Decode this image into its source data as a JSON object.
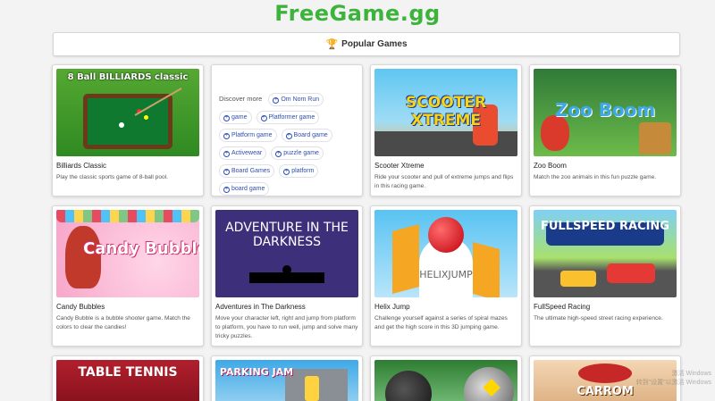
{
  "site": {
    "logo": "FreeGame.gg"
  },
  "section": {
    "title": "Popular Games"
  },
  "discover": {
    "label": "Discover more",
    "tags": [
      "Om Nom Run",
      "game",
      "Platformer game",
      "Platform game",
      "Board game",
      "Activewear",
      "puzzle game",
      "Board Games",
      "platform",
      "board game"
    ]
  },
  "games": [
    {
      "title": "Billiards Classic",
      "desc": "Play the classic sports game of 8-ball pool.",
      "thumb_text": "8 Ball BILLIARDS classic"
    },
    {
      "title": "Scooter Xtreme",
      "desc": "Ride your scooter and pull of extreme jumps and flips in this racing game.",
      "thumb_text": "SCOOTER XTREME"
    },
    {
      "title": "Zoo Boom",
      "desc": "Match the zoo animals in this fun puzzle game.",
      "thumb_text": "Zoo Boom"
    },
    {
      "title": "Candy Bubbles",
      "desc": "Candy Bubble is a bubble shooter game. Match the colors to clear the candies!",
      "thumb_text": "Candy Bubble"
    },
    {
      "title": "Adventures in The Darkness",
      "desc": "Move your character left, right and jump from platform to platform, you have to run well, jump and solve many tricky puzzles.",
      "thumb_text": "ADVENTURE IN THE DARKNESS"
    },
    {
      "title": "Helix Jump",
      "desc": "Challenge yourself against a series of spiral mazes and get the high score in this 3D jumping game.",
      "thumb_text": "HELIXJUMP"
    },
    {
      "title": "FullSpeed Racing",
      "desc": "The ultimate high-speed street racing experience.",
      "thumb_text": "FULLSPEED RACING"
    },
    {
      "title": "",
      "desc": "",
      "thumb_text": "TABLE TENNIS"
    },
    {
      "title": "",
      "desc": "",
      "thumb_text": "PARKING JAM"
    },
    {
      "title": "",
      "desc": "",
      "thumb_text": ""
    },
    {
      "title": "",
      "desc": "",
      "thumb_text": "CARROM"
    }
  ],
  "watermark": {
    "line1": "激活 Windows",
    "line2": "转到\"设置\"以激活 Windows"
  },
  "colors": {
    "logo": "#3cb43c",
    "tag_text": "#2d4fb3"
  }
}
